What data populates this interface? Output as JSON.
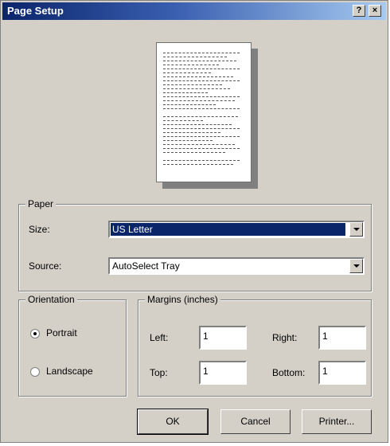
{
  "window": {
    "title": "Page Setup",
    "help_label": "?",
    "close_label": "×"
  },
  "paper": {
    "legend": "Paper",
    "size_label": "Size:",
    "size_value": "US Letter",
    "source_label": "Source:",
    "source_value": "AutoSelect Tray"
  },
  "orientation": {
    "legend": "Orientation",
    "portrait_label": "Portrait",
    "landscape_label": "Landscape",
    "selected": "Portrait"
  },
  "margins": {
    "legend": "Margins (inches)",
    "left_label": "Left:",
    "left_value": "1",
    "right_label": "Right:",
    "right_value": "1",
    "top_label": "Top:",
    "top_value": "1",
    "bottom_label": "Bottom:",
    "bottom_value": "1"
  },
  "buttons": {
    "ok": "OK",
    "cancel": "Cancel",
    "printer": "Printer..."
  }
}
